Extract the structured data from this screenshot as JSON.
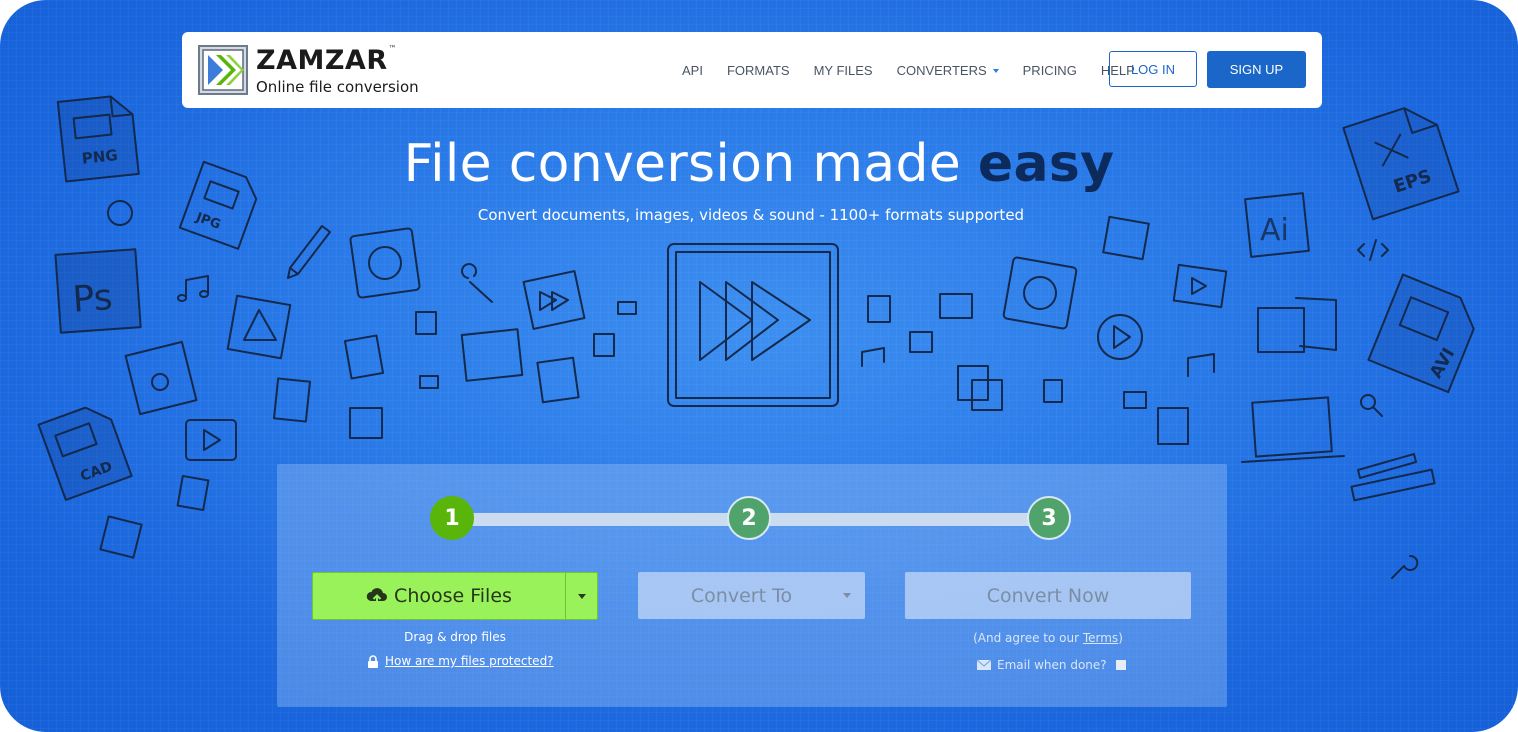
{
  "brand": {
    "name": "ZAMZAR",
    "trademark": "™",
    "tagline": "Online file conversion"
  },
  "nav": {
    "items": [
      {
        "label": "API"
      },
      {
        "label": "FORMATS"
      },
      {
        "label": "MY FILES"
      },
      {
        "label": "CONVERTERS"
      },
      {
        "label": "PRICING"
      },
      {
        "label": "HELP"
      }
    ],
    "login": "LOG IN",
    "signup": "SIGN UP"
  },
  "hero": {
    "title_plain": "File conversion made",
    "title_bold": "easy",
    "subtitle": "Convert documents, images, videos & sound - 1100+ formats supported"
  },
  "decor_labels": {
    "png": "PNG",
    "jpg": "JPG",
    "ps": "Ps",
    "cad": "CAD",
    "eps": "EPS",
    "ai": "Ai",
    "avi": "AVI"
  },
  "steps": [
    "1",
    "2",
    "3"
  ],
  "converter": {
    "choose_files": "Choose Files",
    "drag_drop": "Drag & drop files",
    "protected_link": "How are my files protected?",
    "convert_to": "Convert To",
    "convert_now": "Convert Now",
    "agree_prefix": "(And agree to our ",
    "terms": "Terms",
    "agree_suffix": ")",
    "email_when_done": "Email when done?"
  },
  "colors": {
    "accent_blue": "#1b66c9",
    "step_active": "#5ab50a",
    "choose_files_bg": "#9af25a",
    "title_emphasis": "#0d2a5c"
  },
  "icons": [
    "zamzar-logo-icon",
    "cloud-upload-icon",
    "lock-icon",
    "envelope-icon",
    "caret-down-icon",
    "fast-forward-icon"
  ]
}
